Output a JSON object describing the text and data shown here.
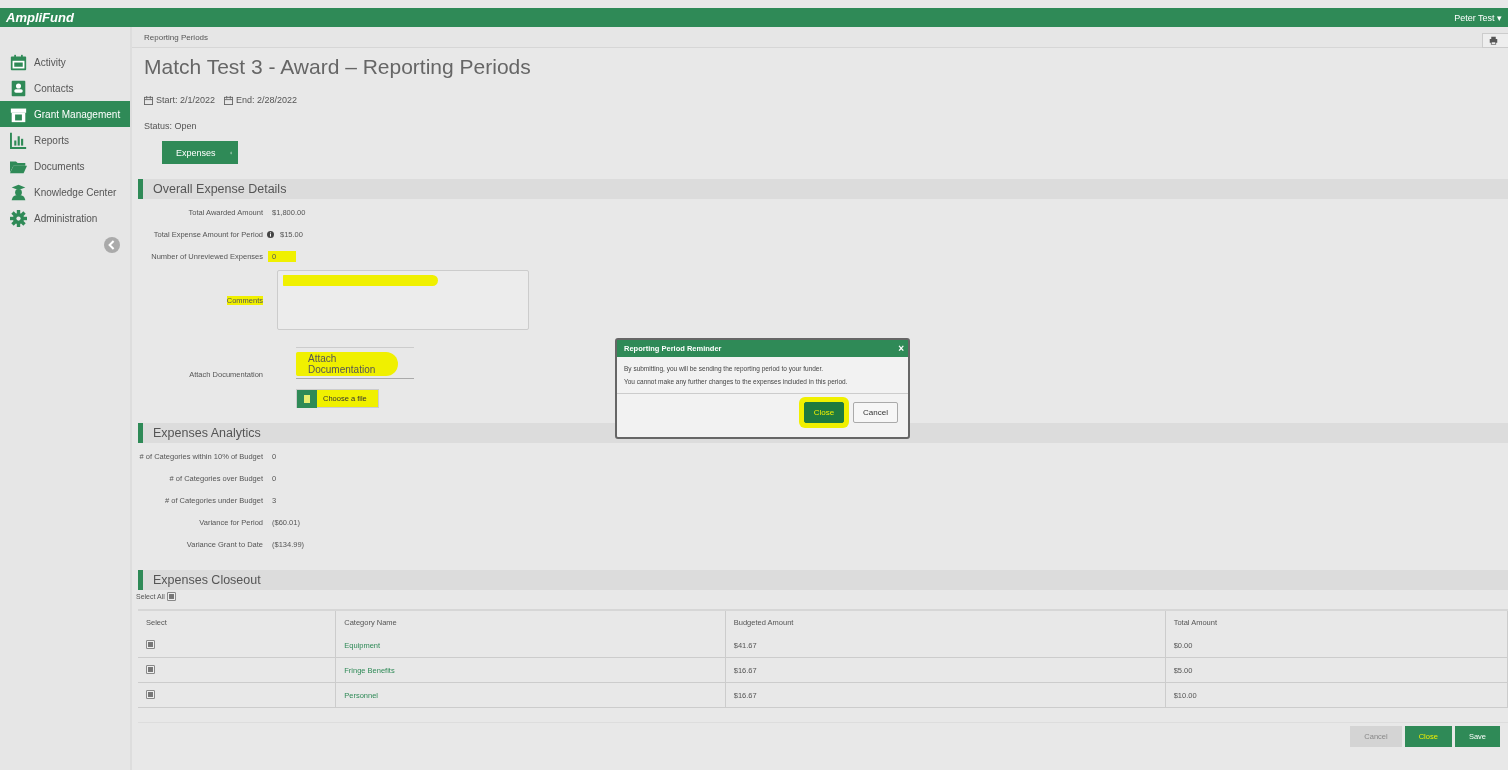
{
  "app": {
    "logo": "AmpliFund",
    "user": "Peter Test ▾"
  },
  "breadcrumb": "Reporting Periods",
  "sidebar": {
    "items": [
      {
        "label": "Activity",
        "selected": false
      },
      {
        "label": "Contacts",
        "selected": false
      },
      {
        "label": "Grant Management",
        "selected": true
      },
      {
        "label": "Reports",
        "selected": false
      },
      {
        "label": "Documents",
        "selected": false
      },
      {
        "label": "Knowledge Center",
        "selected": false
      },
      {
        "label": "Administration",
        "selected": false
      }
    ]
  },
  "page": {
    "title": "Match Test 3 - Award – Reporting Periods",
    "start": "Start: 2/1/2022",
    "end": "End: 2/28/2022",
    "status": "Status: Open",
    "tab_button": "Expenses"
  },
  "overall": {
    "title": "Overall Expense Details",
    "rows": [
      {
        "label": "Total Awarded Amount",
        "value": "$1,800.00",
        "info": false,
        "highlighted": false
      },
      {
        "label": "Total Expense Amount for Period",
        "value": "$15.00",
        "info": true,
        "highlighted": false
      },
      {
        "label": "Number of Unreviewed Expenses",
        "value": "0",
        "info": false,
        "highlighted": true
      }
    ],
    "comments": {
      "label": "Comments",
      "highlighted": true
    },
    "attach": {
      "label": "Attach Documentation",
      "field": "Attach Documentation",
      "button": "Choose a file",
      "highlighted": true
    }
  },
  "analytics": {
    "title": "Expenses Analytics",
    "rows": [
      {
        "label": "# of Categories within 10% of Budget",
        "value": "0"
      },
      {
        "label": "# of Categories over Budget",
        "value": "0"
      },
      {
        "label": "# of Categories under Budget",
        "value": "3"
      },
      {
        "label": "Variance for Period",
        "value": "($60.01)"
      },
      {
        "label": "Variance Grant to Date",
        "value": "($134.99)"
      }
    ]
  },
  "closeout": {
    "title": "Expenses Closeout",
    "select_all": {
      "label": "Select All",
      "checked": true
    },
    "columns": [
      "Select",
      "Category Name",
      "Budgeted Amount",
      "Total Amount"
    ],
    "rows": [
      {
        "checked": true,
        "category": "Equipment",
        "budgeted": "$41.67",
        "total": "$0.00"
      },
      {
        "checked": true,
        "category": "Fringe Benefits",
        "budgeted": "$16.67",
        "total": "$5.00"
      },
      {
        "checked": true,
        "category": "Personnel",
        "budgeted": "$16.67",
        "total": "$10.00"
      }
    ]
  },
  "footer_buttons": [
    {
      "label": "Cancel",
      "kind": "secondary",
      "highlighted": false
    },
    {
      "label": "Close",
      "kind": "primary",
      "highlighted": true
    },
    {
      "label": "Save",
      "kind": "primary",
      "highlighted": false
    }
  ],
  "dialog": {
    "title": "Reporting Period Reminder",
    "close": "×",
    "lines": [
      "By submitting, you will be sending the reporting period to your funder.",
      "You cannot make any further changes to the expenses included in this period."
    ],
    "buttons": [
      {
        "label": "Close",
        "kind": "primary",
        "highlighted": true
      },
      {
        "label": "Cancel",
        "kind": "secondary",
        "highlighted": false
      }
    ]
  }
}
